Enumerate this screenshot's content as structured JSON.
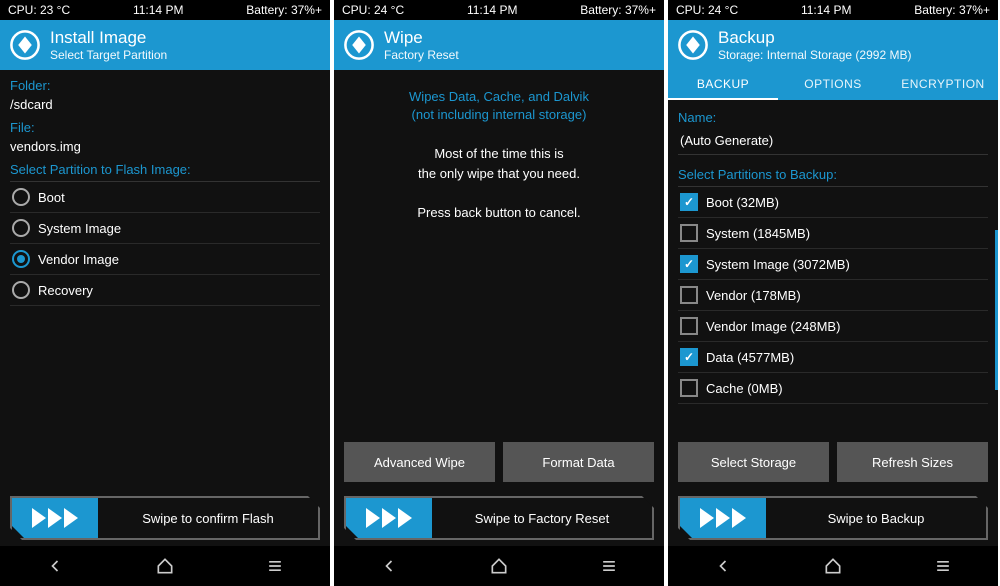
{
  "screens": [
    {
      "status": {
        "cpu": "CPU: 23 °C",
        "time": "11:14 PM",
        "battery": "Battery: 37%+"
      },
      "header": {
        "title": "Install Image",
        "subtitle": "Select Target Partition"
      },
      "folder_label": "Folder:",
      "folder_value": "/sdcard",
      "file_label": "File:",
      "file_value": "vendors.img",
      "section": "Select Partition to Flash Image:",
      "partitions": [
        {
          "label": "Boot",
          "selected": false
        },
        {
          "label": "System Image",
          "selected": false
        },
        {
          "label": "Vendor Image",
          "selected": true
        },
        {
          "label": "Recovery",
          "selected": false
        }
      ],
      "swipe": "Swipe to confirm Flash"
    },
    {
      "status": {
        "cpu": "CPU: 24 °C",
        "time": "11:14 PM",
        "battery": "Battery: 37%+"
      },
      "header": {
        "title": "Wipe",
        "subtitle": "Factory Reset"
      },
      "accent_line1": "Wipes Data, Cache, and Dalvik",
      "accent_line2": "(not including internal storage)",
      "info_line1": "Most of the time this is",
      "info_line2": "the only wipe that you need.",
      "info_line3": "Press back button to cancel.",
      "btn1": "Advanced Wipe",
      "btn2": "Format Data",
      "swipe": "Swipe to Factory Reset"
    },
    {
      "status": {
        "cpu": "CPU: 24 °C",
        "time": "11:14 PM",
        "battery": "Battery: 37%+"
      },
      "header": {
        "title": "Backup",
        "subtitle": "Storage: Internal Storage (2992 MB)"
      },
      "tabs": [
        {
          "label": "BACKUP",
          "active": true
        },
        {
          "label": "OPTIONS",
          "active": false
        },
        {
          "label": "ENCRYPTION",
          "active": false
        }
      ],
      "name_label": "Name:",
      "name_value": "(Auto Generate)",
      "section": "Select Partitions to Backup:",
      "partitions": [
        {
          "label": "Boot (32MB)",
          "checked": true
        },
        {
          "label": "System (1845MB)",
          "checked": false
        },
        {
          "label": "System Image (3072MB)",
          "checked": true
        },
        {
          "label": "Vendor (178MB)",
          "checked": false
        },
        {
          "label": "Vendor Image (248MB)",
          "checked": false
        },
        {
          "label": "Data (4577MB)",
          "checked": true
        },
        {
          "label": "Cache (0MB)",
          "checked": false
        }
      ],
      "btn1": "Select Storage",
      "btn2": "Refresh Sizes",
      "swipe": "Swipe to Backup"
    }
  ]
}
